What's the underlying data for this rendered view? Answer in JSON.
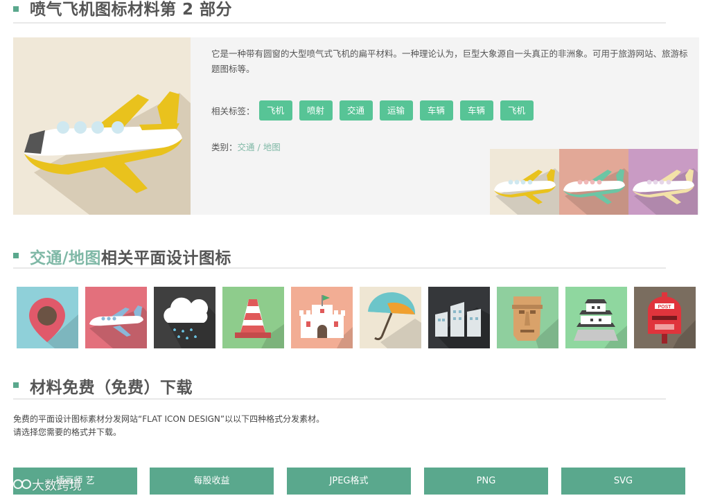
{
  "header": {
    "title": "喷气飞机图标材料第 2 部分"
  },
  "detail": {
    "description": "它是一种带有圆窗的大型喷气式飞机的扁平材料。一种理论认为，巨型大象源自一头真正的非洲象。可用于旅游网站、旅游标题图标等。",
    "tags_label": "相关标签：",
    "tags": [
      "飞机",
      "喷射",
      "交通",
      "运输",
      "车辆",
      "车辆",
      "飞机"
    ],
    "category_label": "类别：",
    "category_primary": "交通",
    "category_separator": "/",
    "category_secondary": "地图",
    "variant_colors": [
      "#f0e8d8",
      "#e2a897",
      "#c99bc4"
    ]
  },
  "related": {
    "title_category": "交通/地图",
    "title_rest": "相关平面设计图标",
    "icons": [
      {
        "icon": "map-pin-icon",
        "bg": "#8fd0d9"
      },
      {
        "icon": "airplane-icon",
        "bg": "#e3707c"
      },
      {
        "icon": "rain-cloud-icon",
        "bg": "#3f3f3f"
      },
      {
        "icon": "traffic-cone-icon",
        "bg": "#8ecc8c"
      },
      {
        "icon": "castle-icon",
        "bg": "#f2ad94"
      },
      {
        "icon": "umbrella-icon",
        "bg": "#efe6d3"
      },
      {
        "icon": "buildings-icon",
        "bg": "#35373a"
      },
      {
        "icon": "moai-icon",
        "bg": "#8fcf9e"
      },
      {
        "icon": "japanese-castle-icon",
        "bg": "#8fd79f"
      },
      {
        "icon": "mailbox-icon",
        "bg": "#7a6d5f"
      }
    ]
  },
  "download": {
    "title": "材料免费（免费）下载",
    "text_line1": "免费的平面设计图标素材分发网站“FLAT ICON DESIGN”以以下四种格式分发素材。",
    "text_line2": "请选择您需要的格式并下载。",
    "buttons": [
      "插画师 艺",
      "每股收益",
      "JPEG格式",
      "PNG",
      "SVG"
    ]
  },
  "watermark": {
    "text": "大数跨境"
  },
  "colors": {
    "accent": "#5aa88d",
    "tag": "#57c496",
    "link": "#7fb8a6"
  }
}
